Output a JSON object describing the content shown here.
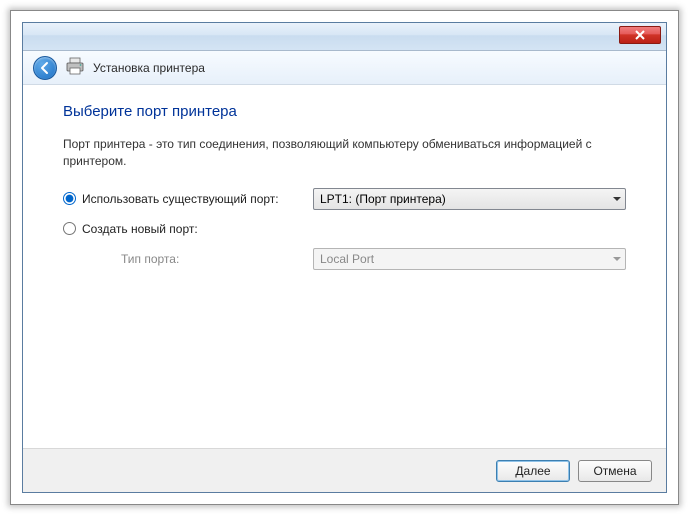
{
  "header": {
    "title": "Установка принтера"
  },
  "wizard": {
    "title": "Выберите порт принтера",
    "description": "Порт принтера - это тип соединения, позволяющий компьютеру обмениваться информацией с принтером."
  },
  "options": {
    "use_existing": {
      "label": "Использовать существующий порт:",
      "selected_value": "LPT1: (Порт принтера)",
      "checked": true
    },
    "create_new": {
      "label": "Создать новый порт:",
      "checked": false,
      "port_type_label": "Тип порта:",
      "selected_value": "Local Port"
    }
  },
  "footer": {
    "next": "Далее",
    "cancel": "Отмена"
  }
}
